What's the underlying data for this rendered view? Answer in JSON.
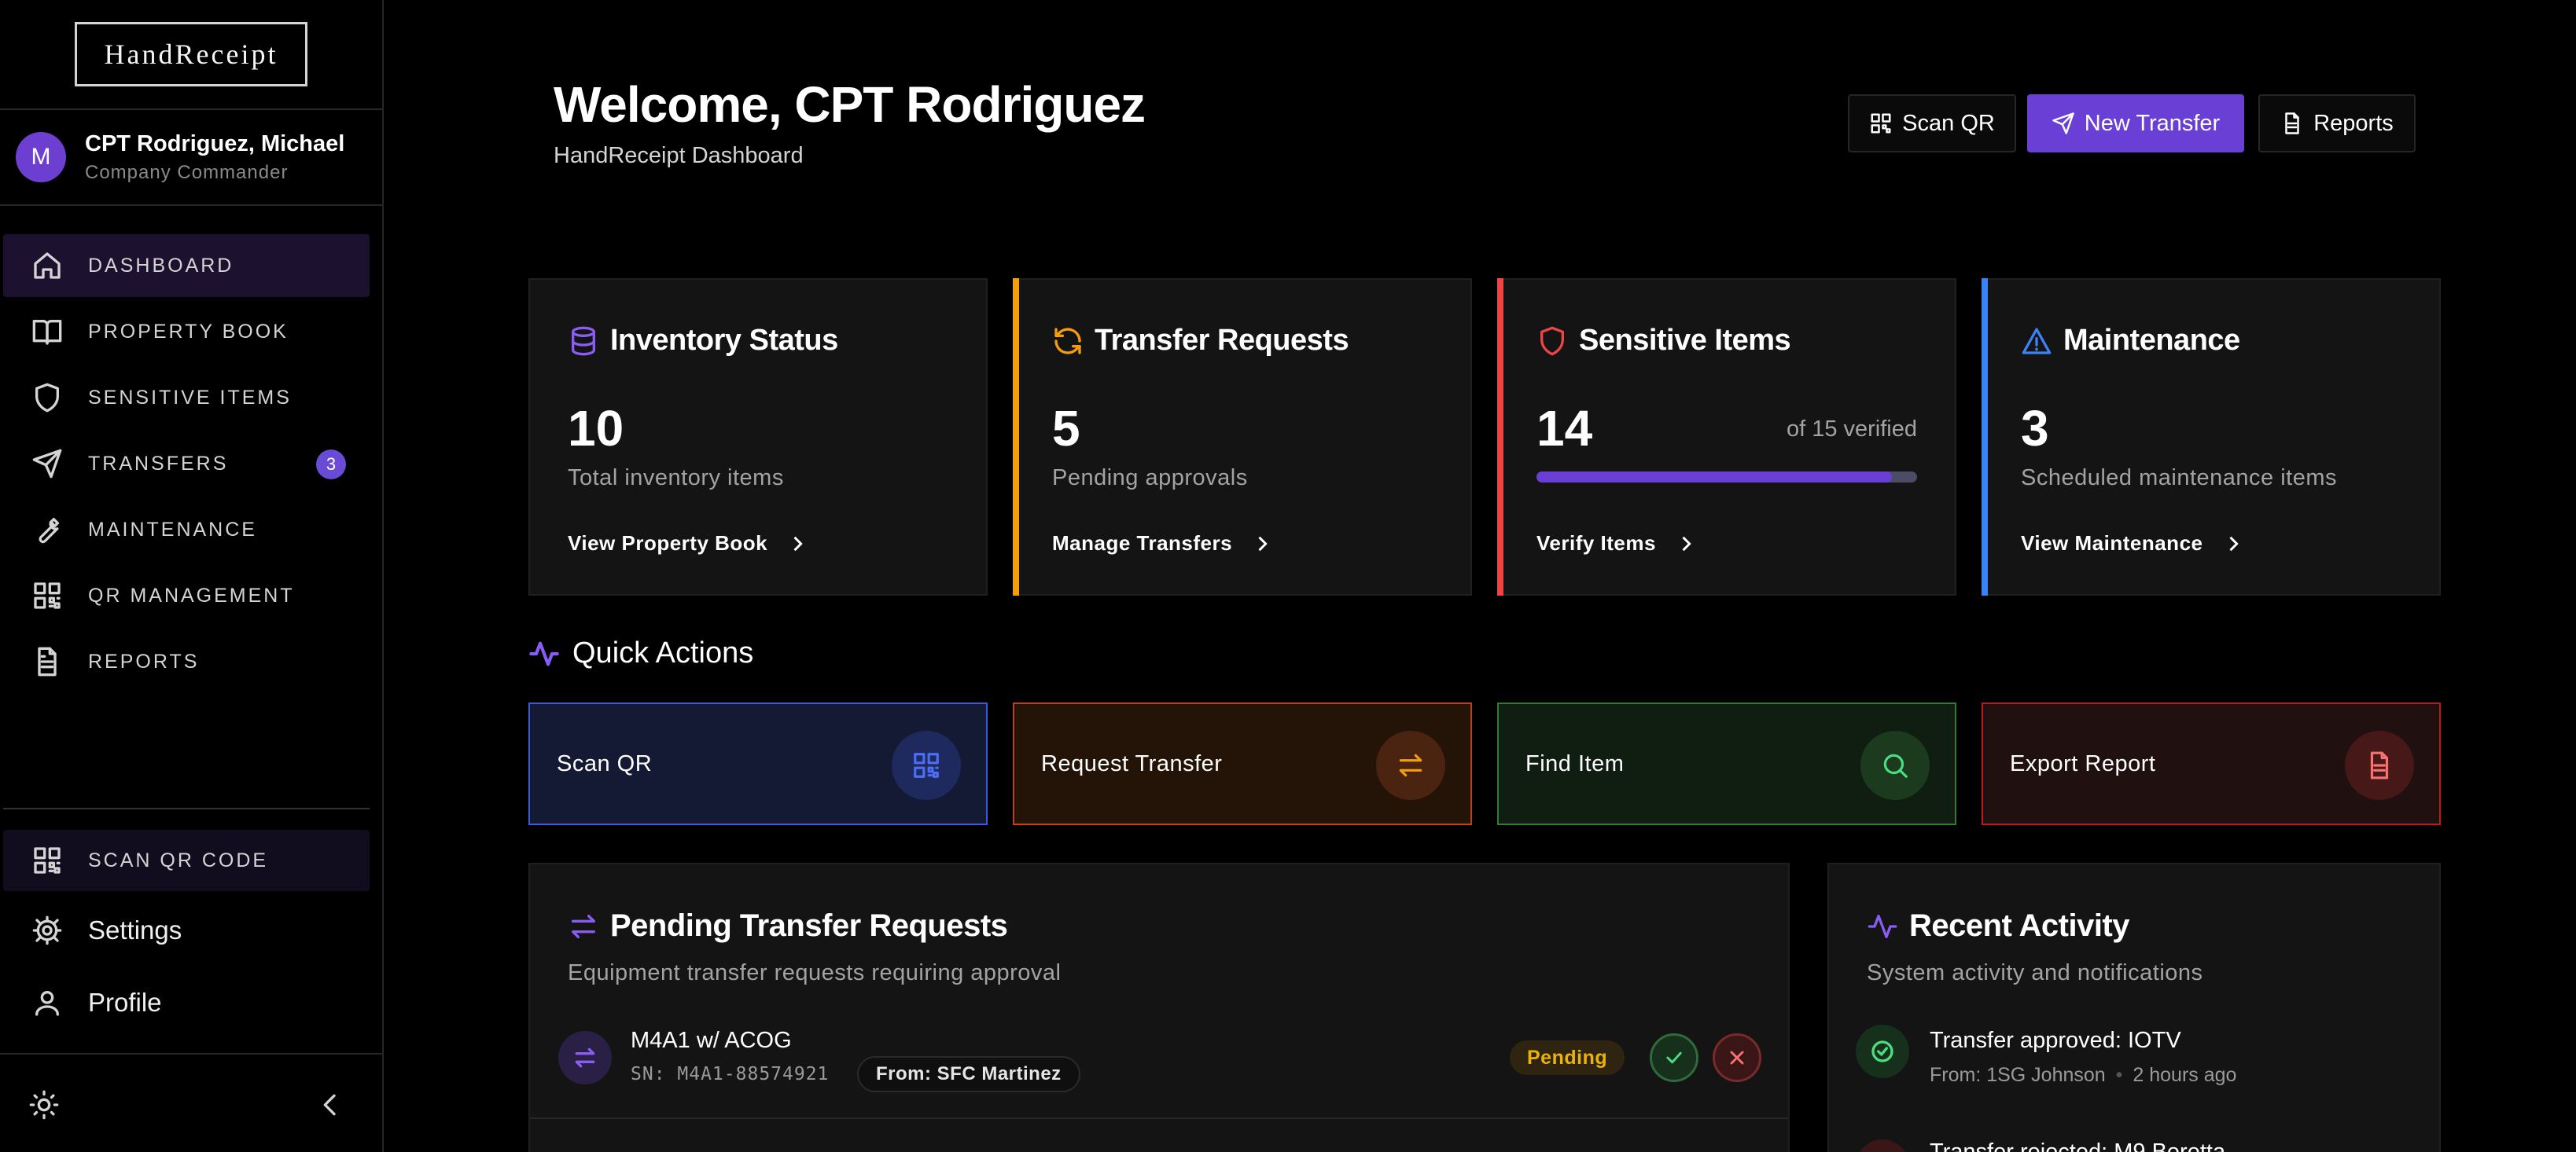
{
  "brand": {
    "logo_text": "HandReceipt"
  },
  "user": {
    "initial": "M",
    "name": "CPT Rodriguez, Michael",
    "role": "Company Commander"
  },
  "nav": {
    "items": [
      {
        "label": "DASHBOARD",
        "icon": "home-icon"
      },
      {
        "label": "PROPERTY BOOK",
        "icon": "book-open-icon"
      },
      {
        "label": "SENSITIVE ITEMS",
        "icon": "shield-icon"
      },
      {
        "label": "TRANSFERS",
        "icon": "send-icon",
        "badge": "3"
      },
      {
        "label": "MAINTENANCE",
        "icon": "wrench-icon"
      },
      {
        "label": "QR MANAGEMENT",
        "icon": "qr-code-icon"
      },
      {
        "label": "REPORTS",
        "icon": "file-text-icon"
      }
    ],
    "scan_qr_code": "SCAN QR CODE",
    "settings": "Settings",
    "profile": "Profile"
  },
  "header": {
    "title": "Welcome, CPT Rodriguez",
    "subtitle": "HandReceipt Dashboard",
    "buttons": {
      "scan_qr": "Scan QR",
      "new_transfer": "New Transfer",
      "reports": "Reports"
    }
  },
  "stats": {
    "inventory": {
      "title": "Inventory Status",
      "value": "10",
      "desc": "Total inventory items",
      "link": "View Property Book",
      "accent": "#8b5cf6"
    },
    "transfers": {
      "title": "Transfer Requests",
      "value": "5",
      "desc": "Pending approvals",
      "link": "Manage Transfers",
      "accent": "#f59e0b"
    },
    "sensitive": {
      "title": "Sensitive Items",
      "value": "14",
      "verified_text": "of 15 verified",
      "progress_fraction": 0.933,
      "link": "Verify Items",
      "accent": "#ef4444"
    },
    "maintenance": {
      "title": "Maintenance",
      "value": "3",
      "desc": "Scheduled maintenance items",
      "link": "View Maintenance",
      "accent": "#3b82f6"
    }
  },
  "quick_actions": {
    "title": "Quick Actions",
    "items": [
      {
        "label": "Scan QR",
        "icon": "qr-code-icon",
        "color": "#3b5bdb"
      },
      {
        "label": "Request Transfer",
        "icon": "arrows-swap-icon",
        "color": "#c2410c"
      },
      {
        "label": "Find Item",
        "icon": "search-icon",
        "color": "#2f7d32"
      },
      {
        "label": "Export Report",
        "icon": "file-text-icon",
        "color": "#b91c1c"
      }
    ]
  },
  "pending_transfers": {
    "title": "Pending Transfer Requests",
    "subtitle": "Equipment transfer requests requiring approval",
    "rows": [
      {
        "item": "M4A1 w/ ACOG",
        "sn": "SN: M4A1-88574921",
        "from": "From: SFC Martinez",
        "status": "Pending"
      }
    ]
  },
  "recent_activity": {
    "title": "Recent Activity",
    "subtitle": "System activity and notifications",
    "rows": [
      {
        "title": "Transfer approved: IOTV",
        "from": "From: 1SG Johnson",
        "time": "2 hours ago"
      },
      {
        "title": "Transfer rejected: M9 Beretta"
      }
    ]
  }
}
